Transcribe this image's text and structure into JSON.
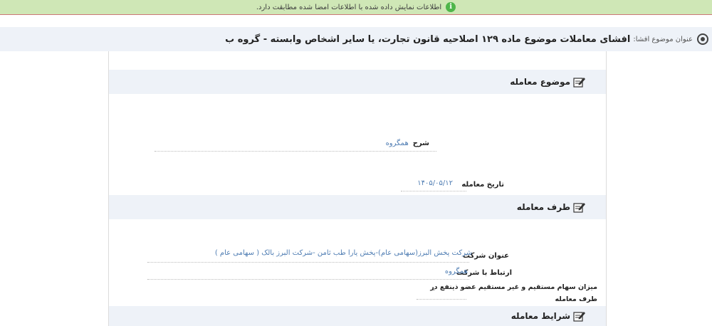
{
  "notice": {
    "text": "اطلاعات نمایش داده شده با اطلاعات امضا شده مطابقت دارد.",
    "icon": "info-icon",
    "color": "#cfe7b6"
  },
  "header": {
    "label": "عنوان موضوع افشا:",
    "title": "افشای معاملات موضوع ماده ۱۲۹ اصلاحیه قانون تجارت، یا سایر اشخاص وابسته - گروه ب",
    "icon": "target-icon"
  },
  "sections": {
    "subject": {
      "title": "موضوع معامله",
      "description_label": "شرح",
      "description_value": "همگروه",
      "date_label": "تاریخ معامله",
      "date_value": "۱۴۰۵/۰۵/۱۲"
    },
    "party": {
      "title": "طرف معامله",
      "company_label": "عنوان شرکت",
      "company_value": "شرکت پخش البرز(سهامی عام)-پخش یارا طب ثامن -شرکت البرز بالک ( سهامی عام )",
      "relation_label": "ارتباط با شرکت",
      "relation_value": "همگروه",
      "shares_label_line1": "میزان سهام مستقیم و غیر مستقیم عضو ذینفع در",
      "shares_label_line2": "طرف معامله",
      "shares_value": "-"
    },
    "conditions": {
      "title": "شرایط معامله"
    }
  },
  "colors": {
    "link": "#4f7db3",
    "section_bg": "#eef2f8"
  }
}
